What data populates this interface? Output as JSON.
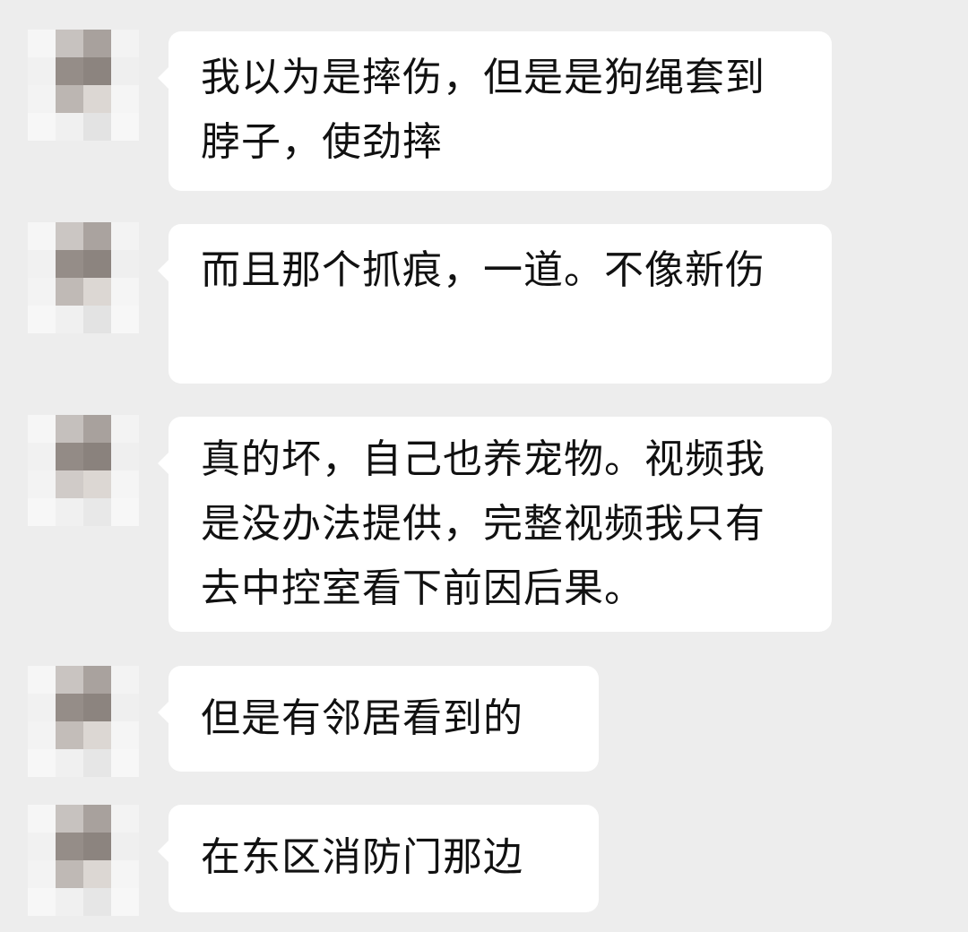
{
  "messages": [
    {
      "text": "我以为是摔伤，但是是狗绳套到脖子，使劲摔"
    },
    {
      "text": "而且那个抓痕，一道。不像新伤"
    },
    {
      "text": "真的坏，自己也养宠物。视频我是没办法提供，完整视频我只有去中控室看下前因后果。"
    },
    {
      "text": "但是有邻居看到的"
    },
    {
      "text": "在东区消防门那边"
    }
  ],
  "colors": {
    "background": "#ededed",
    "bubble": "#ffffff",
    "text": "#111111",
    "avatar_mosaic": [
      "#f4f4f4",
      "#a59d98",
      "#8d8580",
      "#d7d2ce",
      "#e6e6e6"
    ]
  }
}
